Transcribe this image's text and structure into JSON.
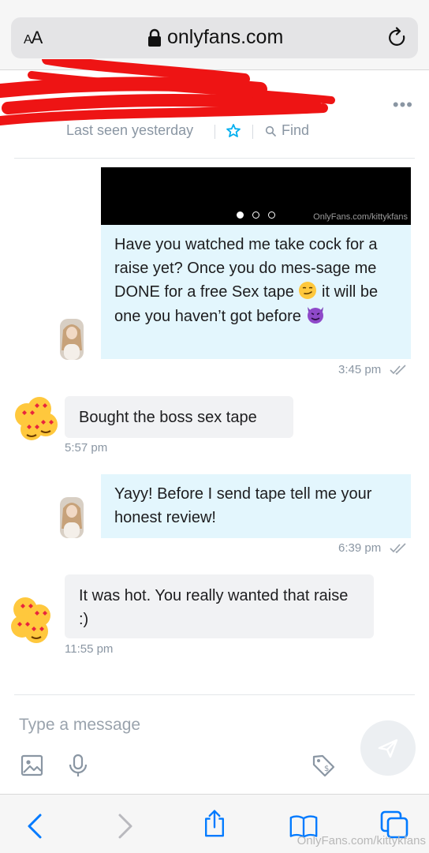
{
  "browser": {
    "text_size_label_small": "A",
    "text_size_label_large": "A",
    "url": "onlyfans.com"
  },
  "chat_header": {
    "last_seen": "Last seen yesterday",
    "find_label": "Find",
    "more_label": "•••"
  },
  "messages": [
    {
      "direction": "outgoing",
      "media_watermark": "OnlyFans.com/kittykfans",
      "text_part1": "Have you watched me take cock for a raise yet? Once you do mes-sage me DONE for a free Sex tape",
      "emoji1": "smirking-face",
      "text_part2": "it will be one you haven’t got before",
      "emoji2": "smiling-face-with-horns",
      "time": "3:45 pm"
    },
    {
      "direction": "incoming",
      "text": "Bought the boss sex tape",
      "time": "5:57 pm"
    },
    {
      "direction": "outgoing",
      "text": "Yayy! Before I send tape tell me your honest review!",
      "time": "6:39 pm"
    },
    {
      "direction": "incoming",
      "text": "It was hot. You really wanted that raise :)",
      "time": "11:55 pm"
    }
  ],
  "composer": {
    "placeholder": "Type a message"
  },
  "watermark": "OnlyFans.com/kittykfans",
  "colors": {
    "outgoing_bubble": "#e3f6fd",
    "incoming_bubble": "#f1f2f4",
    "accent_blue": "#00aff0",
    "ios_blue": "#007aff",
    "muted_text": "#8a96a3"
  }
}
